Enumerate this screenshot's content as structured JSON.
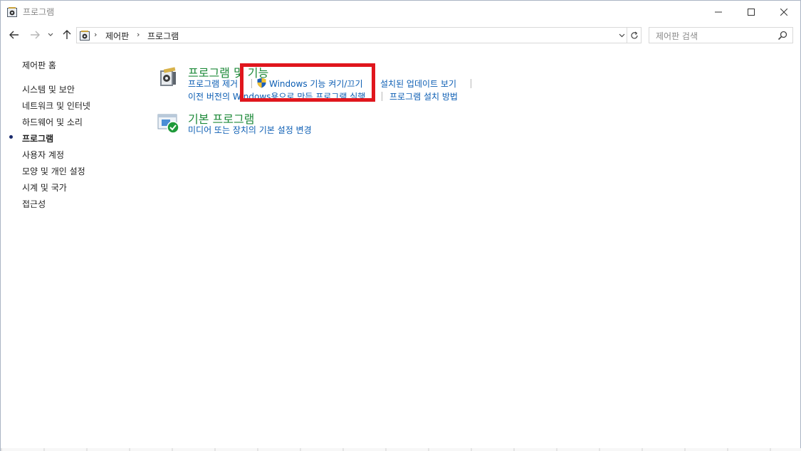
{
  "window": {
    "title": "프로그램",
    "minimize_label": "",
    "maximize_label": "",
    "close_label": ""
  },
  "address": {
    "crumbs": [
      "제어판",
      "프로그램"
    ],
    "search_placeholder": "제어판 검색"
  },
  "sidebar": {
    "home": "제어판 홈",
    "items": [
      {
        "label": "시스템 및 보안",
        "active": false
      },
      {
        "label": "네트워크 및 인터넷",
        "active": false
      },
      {
        "label": "하드웨어 및 소리",
        "active": false
      },
      {
        "label": "프로그램",
        "active": true
      },
      {
        "label": "사용자 계정",
        "active": false
      },
      {
        "label": "모양 및 개인 설정",
        "active": false
      },
      {
        "label": "시계 및 국가",
        "active": false
      },
      {
        "label": "접근성",
        "active": false
      }
    ]
  },
  "main": {
    "categories": [
      {
        "title": "프로그램 및 기능",
        "links_row1": [
          "프로그램 제거",
          "Windows 기능 켜기/끄기",
          "설치된 업데이트 보기"
        ],
        "links_row2": [
          "이전 버전의 Windows용으로 만든 프로그램 실행",
          "프로그램 설치 방법"
        ]
      },
      {
        "title": "기본 프로그램",
        "links_row1": [
          "미디어 또는 장치의 기본 설정 변경"
        ]
      }
    ]
  },
  "colors": {
    "link": "#0b5db3",
    "category_title": "#1e8a3a",
    "highlight_box": "#e0161d",
    "bullet": "#1a2a6c"
  },
  "icons": {
    "app": "control-panel-programs-icon",
    "back": "back-arrow-icon",
    "forward": "forward-arrow-icon",
    "recent": "chevron-down-icon",
    "up": "up-arrow-icon",
    "refresh": "refresh-icon",
    "search": "search-icon",
    "shield": "uac-shield-icon",
    "programs_features": "programs-features-icon",
    "default_programs": "default-programs-icon"
  }
}
